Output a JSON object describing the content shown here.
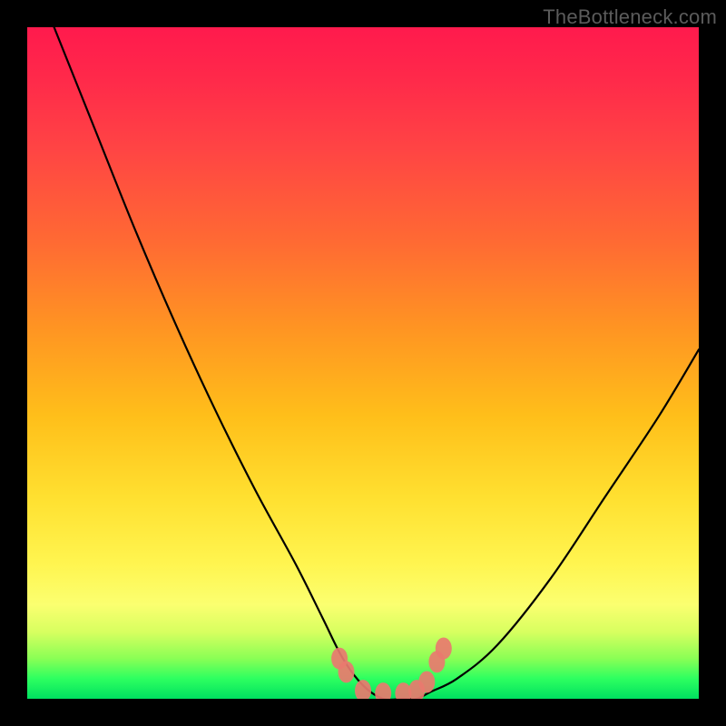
{
  "watermark": "TheBottleneck.com",
  "chart_data": {
    "type": "line",
    "title": "",
    "xlabel": "",
    "ylabel": "",
    "xlim": [
      0,
      100
    ],
    "ylim": [
      0,
      100
    ],
    "series": [
      {
        "name": "bottleneck-curve",
        "x": [
          4,
          10,
          16,
          22,
          28,
          34,
          40,
          44,
          47,
          50,
          53,
          56,
          58,
          60,
          64,
          70,
          78,
          86,
          94,
          100
        ],
        "values": [
          100,
          85,
          70,
          56,
          43,
          31,
          20,
          12,
          6,
          2,
          0,
          0,
          0,
          1,
          3,
          8,
          18,
          30,
          42,
          52
        ]
      }
    ],
    "markers": {
      "name": "valley-markers",
      "color": "#e97a6f",
      "x": [
        46.5,
        47.5,
        50,
        53,
        56,
        58,
        59.5,
        61,
        62
      ],
      "values": [
        6,
        4,
        1.2,
        0.8,
        0.8,
        1.2,
        2.5,
        5.5,
        7.5
      ]
    },
    "background_gradient": {
      "top": "#ff1a4d",
      "mid": "#ffe030",
      "bottom": "#00e060"
    }
  }
}
